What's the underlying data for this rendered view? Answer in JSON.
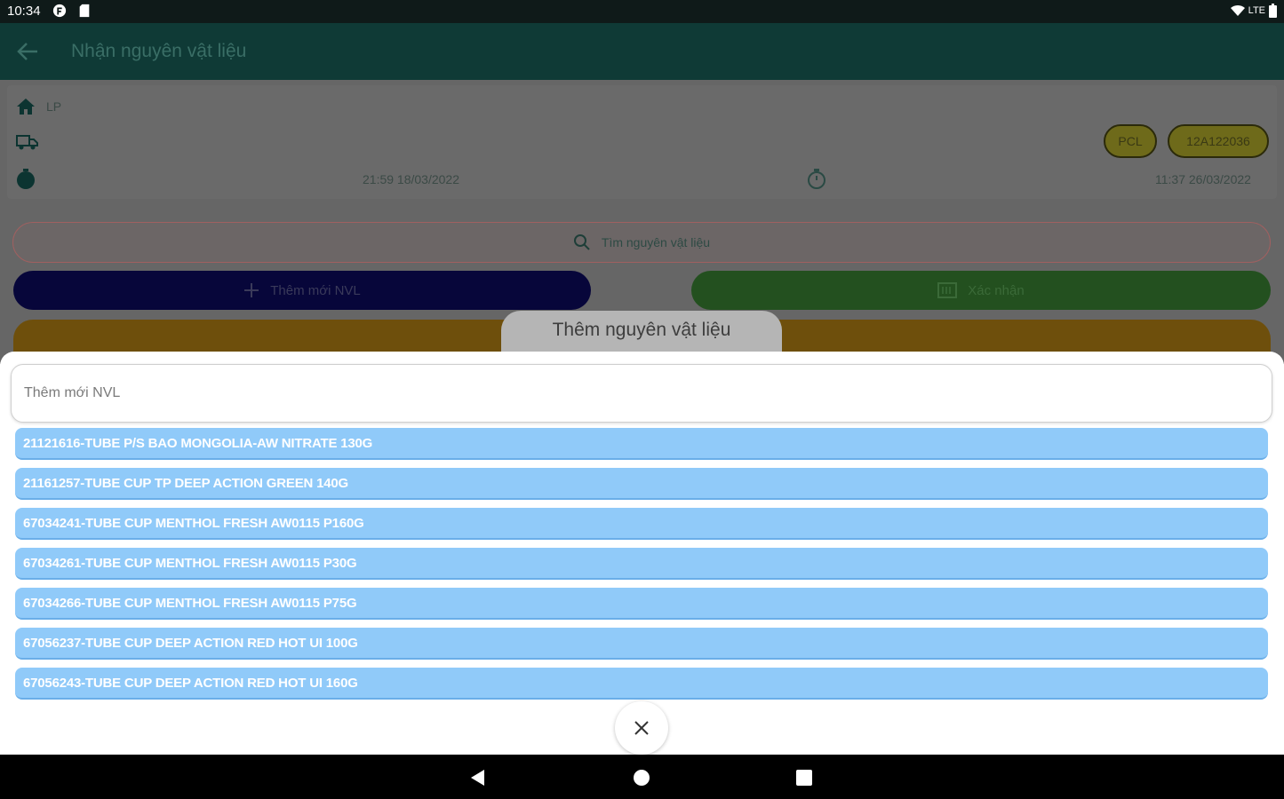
{
  "status_bar": {
    "time": "10:34",
    "network": "LTE"
  },
  "app_bar": {
    "title": "Nhận nguyên vật liệu"
  },
  "info": {
    "location": "LP",
    "start_time": "21:59 18/03/2022",
    "end_time": "11:37 26/03/2022",
    "chips": [
      "PCL",
      "12A122036"
    ]
  },
  "search": {
    "placeholder": "Tìm nguyên vật liệu"
  },
  "buttons": {
    "add_label": "Thêm mới NVL",
    "confirm_label": "Xác nhận"
  },
  "sheet": {
    "tab_title": "Thêm nguyên vật liệu",
    "input_placeholder": "Thêm mới NVL",
    "items": [
      "21121616-TUBE P/S BAO MONGOLIA-AW NITRATE 130G",
      "21161257-TUBE CUP TP DEEP ACTION GREEN 140G",
      "67034241-TUBE CUP MENTHOL FRESH AW0115 P160G",
      "67034261-TUBE CUP MENTHOL FRESH AW0115 P30G",
      "67034266-TUBE CUP MENTHOL FRESH AW0115 P75G",
      "67056237-TUBE CUP DEEP ACTION RED HOT UI 100G",
      "67056243-TUBE CUP DEEP ACTION RED HOT UI 160G"
    ]
  },
  "colors": {
    "app_bar": "#0f3a36",
    "list_item": "#90caf9",
    "add_button": "#07063a",
    "confirm_button": "#23501f"
  }
}
